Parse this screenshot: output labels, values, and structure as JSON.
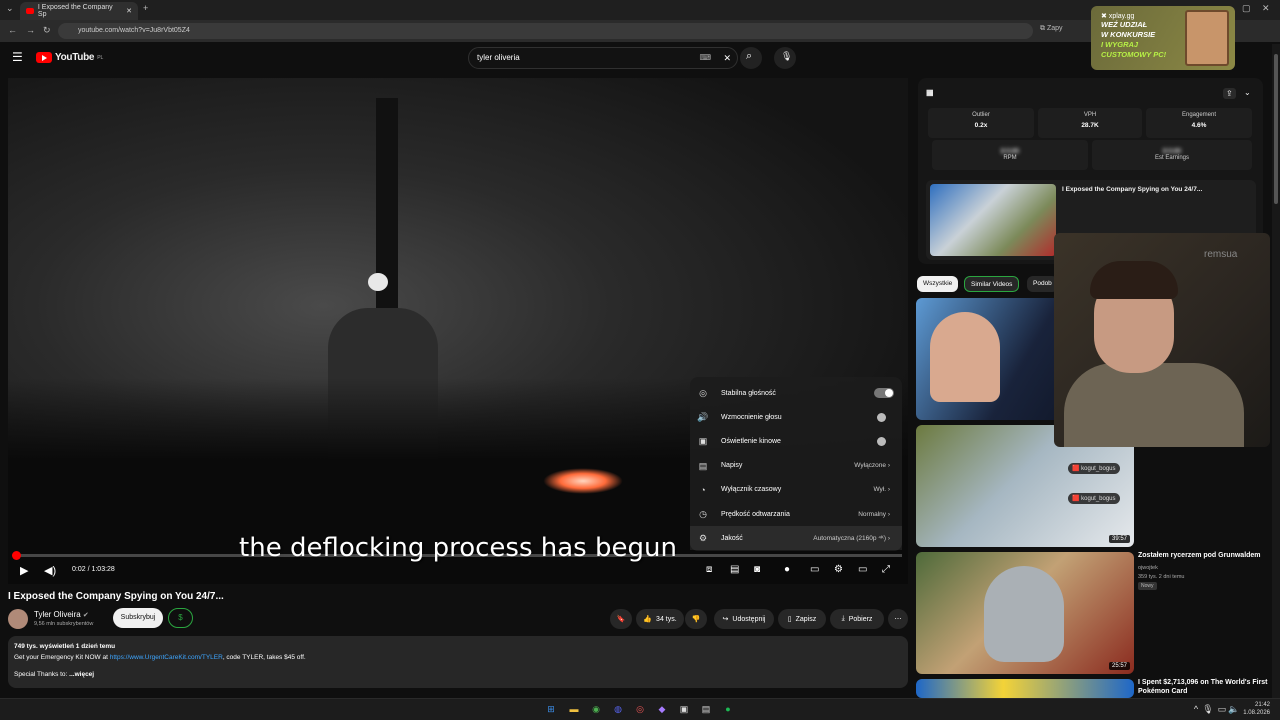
{
  "browser": {
    "tab_title": "I Exposed the Company Sp",
    "url": "youtube.com/watch?v=Ju8rVbt05Z4",
    "save_label": "Zapy"
  },
  "youtube": {
    "logo": "YouTube",
    "logo_region": "PL",
    "search_value": "tyler oliveria"
  },
  "video": {
    "caption": "the deflocking process has begun",
    "time": "0:02 / 1:03:28",
    "progress_fraction": 0.0005,
    "settings": [
      {
        "label": "Stabilna głośność",
        "value": "",
        "control": "toggle-on",
        "icon": "◎"
      },
      {
        "label": "Wzmocnienie głosu",
        "value": "",
        "control": "dot",
        "icon": "🔊"
      },
      {
        "label": "Oświetlenie kinowe",
        "value": "",
        "control": "dot",
        "icon": "▣"
      },
      {
        "label": "Napisy",
        "value": "Wyłączone ›",
        "control": "",
        "icon": "▤"
      },
      {
        "label": "Wyłącznik czasowy",
        "value": "Wył. ›",
        "control": "",
        "icon": "◔"
      },
      {
        "label": "Prędkość odtwarzania",
        "value": "Normalny ›",
        "control": "",
        "icon": "◷"
      },
      {
        "label": "Jakość",
        "value": "Automatyczna (2160p ⁴ᴷ) ›",
        "control": "",
        "icon": "⚙"
      }
    ]
  },
  "meta": {
    "title": "I Exposed the Company Spying on You 24/7...",
    "channel": "Tyler Oliveira",
    "subscribers": "9,56 mln subskrybentów",
    "subscribe": "Subskrybuj",
    "dollar": "$",
    "likes": "34 tys.",
    "share": "Udostępnij",
    "save": "Zapisz",
    "download": "Pobierz",
    "views_line": "749 tys. wyświetleń  1 dzień temu",
    "desc_line1_pre": "Get your Emergency Kit NOW at ",
    "desc_link": "https://www.UrgentCareKit.com/TYLER",
    "desc_line1_post": ", code TYLER, takes $45 off.",
    "desc_line3_pre": "Special Thanks to:",
    "desc_more": "...więcej"
  },
  "extension": {
    "labels": [
      "Outlier",
      "VPH",
      "Engagement"
    ],
    "values": [
      "0.2x",
      "28.7K",
      "4.6%"
    ],
    "rpm_label": "RPM",
    "earnings_label": "Est Earnings",
    "blurred": "$ 0.00",
    "mini_title": "I Exposed the Company Spying on You 24/7..."
  },
  "chips": [
    "Wszystkie",
    "Similar Videos",
    "Podob"
  ],
  "related": [
    {
      "title": "",
      "duration": "",
      "channel": "",
      "meta": ""
    },
    {
      "title": "",
      "duration": "39:57",
      "channel": "",
      "meta": ""
    },
    {
      "title": "Zostałem rycerzem pod Grunwaldem",
      "duration": "25:57",
      "channel": "ojwojtek",
      "meta": "359 tys.  2 dni temu",
      "badge": "Nowy"
    },
    {
      "title": "I Spent $2,713,096 on The World's First Pokémon Card",
      "duration": "",
      "channel": "",
      "meta": ""
    }
  ],
  "ad": {
    "brand": "xplay.gg",
    "line1": "WEŹ UDZIAŁ",
    "line2": "W KONKURSIE",
    "line3": "I WYGRAJ",
    "line4": "CUSTOMOWY PC!"
  },
  "webcam_text": "remsua",
  "chat": [
    "kogut_bogus",
    "kogut_bogus"
  ],
  "clock": {
    "time": "21:42",
    "date": "1.08.2026"
  },
  "colors": {
    "accent": "#ff0000",
    "link": "#3ea6ff",
    "green": "#2ba640"
  }
}
